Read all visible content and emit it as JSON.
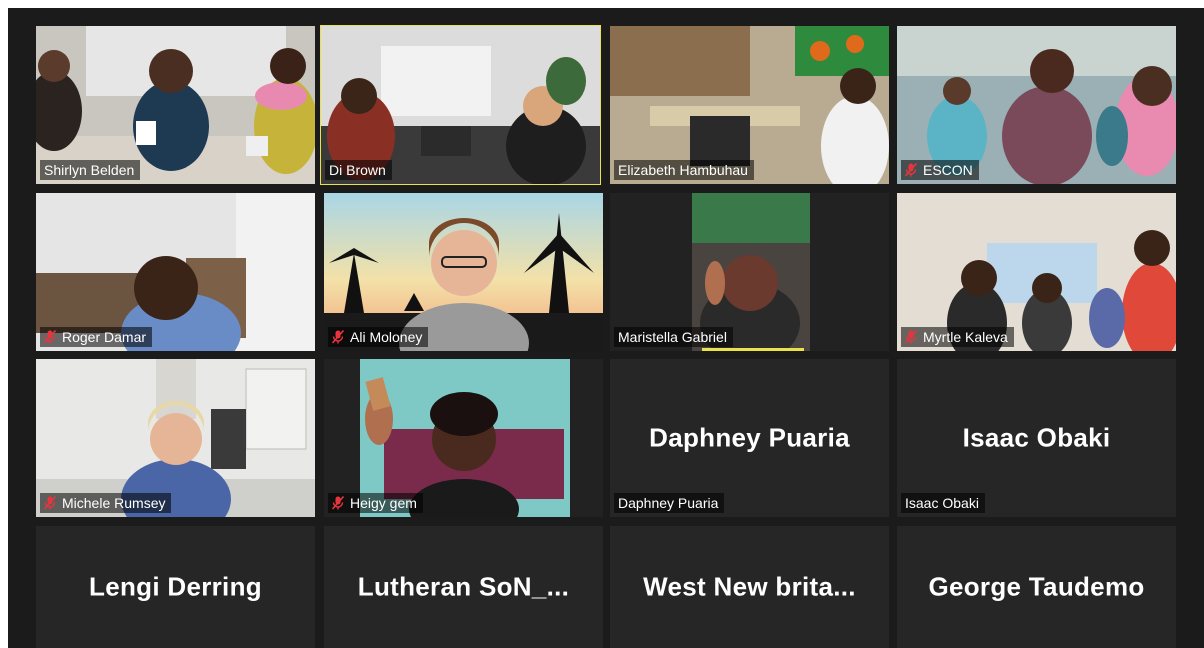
{
  "participants": [
    {
      "name": "Shirlyn Belden",
      "muted": false
    },
    {
      "name": "Di Brown",
      "muted": false,
      "active_speaker": true
    },
    {
      "name": "Elizabeth Hambuhau",
      "muted": false
    },
    {
      "name": "ESCON",
      "muted": true
    },
    {
      "name": "Roger Damar",
      "muted": true
    },
    {
      "name": "Ali Moloney",
      "muted": true
    },
    {
      "name": "Maristella Gabriel",
      "muted": false
    },
    {
      "name": "Myrtle Kaleva",
      "muted": true
    },
    {
      "name": "Michele Rumsey",
      "muted": true
    },
    {
      "name": "Heigy gem",
      "muted": true
    },
    {
      "name": "Daphney Puaria",
      "muted": false,
      "video_off": true,
      "display_name": "Daphney Puaria"
    },
    {
      "name": "Isaac Obaki",
      "muted": false,
      "video_off": true,
      "display_name": "Isaac Obaki"
    },
    {
      "name": "",
      "video_off": true,
      "display_name": "Lengi Derring"
    },
    {
      "name": "",
      "video_off": true,
      "display_name": "Lutheran  SoN_..."
    },
    {
      "name": "",
      "video_off": true,
      "display_name": "West  New  brita..."
    },
    {
      "name": "",
      "video_off": true,
      "display_name": "George Taudemo"
    }
  ],
  "colors": {
    "muted_icon": "#e8343c",
    "active_border": "#e9e24a",
    "tile_bg": "#262626",
    "app_bg": "#1b1b1b"
  }
}
